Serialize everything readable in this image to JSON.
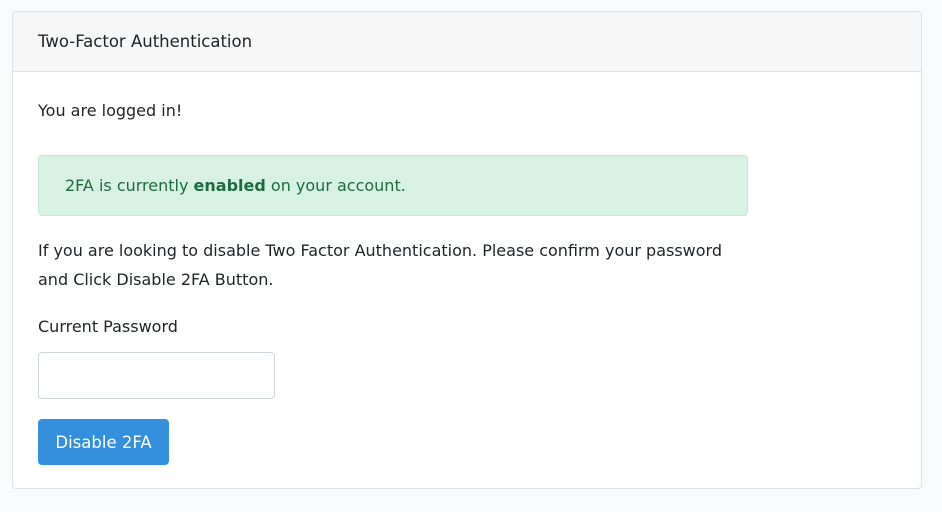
{
  "card": {
    "title": "Two-Factor Authentication"
  },
  "body": {
    "logged_in_text": "You are logged in!",
    "alert": {
      "prefix": "2FA is currently ",
      "status": "enabled",
      "suffix": " on your account."
    },
    "instructions": "If you are looking to disable Two Factor Authentication. Please confirm your password and Click Disable 2FA Button.",
    "password_label": "Current Password",
    "password_value": "",
    "disable_button_label": "Disable 2FA"
  },
  "colors": {
    "primary": "#3490dc",
    "success_bg": "#d7f2e3",
    "success_text": "#1d6b3f"
  }
}
